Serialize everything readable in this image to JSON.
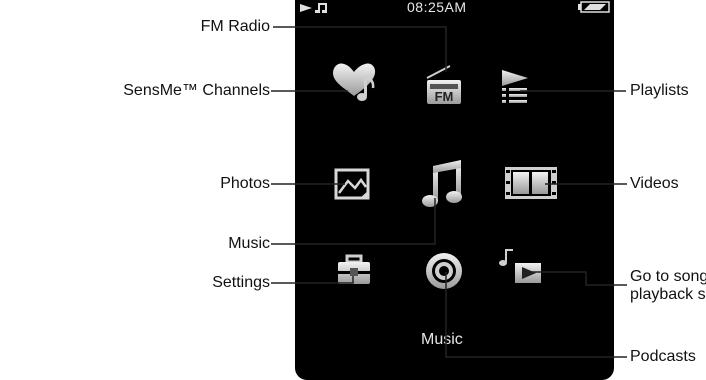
{
  "status_bar": {
    "time": "08:25AM",
    "play_state_icon": "play-icon",
    "music_note_icon": "music-note-icon",
    "battery_icon": "battery-icon"
  },
  "screen_caption": "Music",
  "labels": {
    "fm_radio": "FM Radio",
    "sensme": "SensMe™ Channels",
    "playlists": "Playlists",
    "photos": "Photos",
    "videos": "Videos",
    "music": "Music",
    "settings": "Settings",
    "go_to_song_line1": "Go to song",
    "go_to_song_line2": "playback s",
    "podcasts": "Podcasts"
  },
  "menu_icons": [
    "heart-music-icon",
    "fm-radio-icon",
    "playlist-icon",
    "photo-icon",
    "music-note-icon",
    "film-icon",
    "toolbox-icon",
    "podcast-icon",
    "now-playing-icon"
  ],
  "colors": {
    "screen": "#000000",
    "icon": "#d4d4d4",
    "line": "#222222"
  }
}
